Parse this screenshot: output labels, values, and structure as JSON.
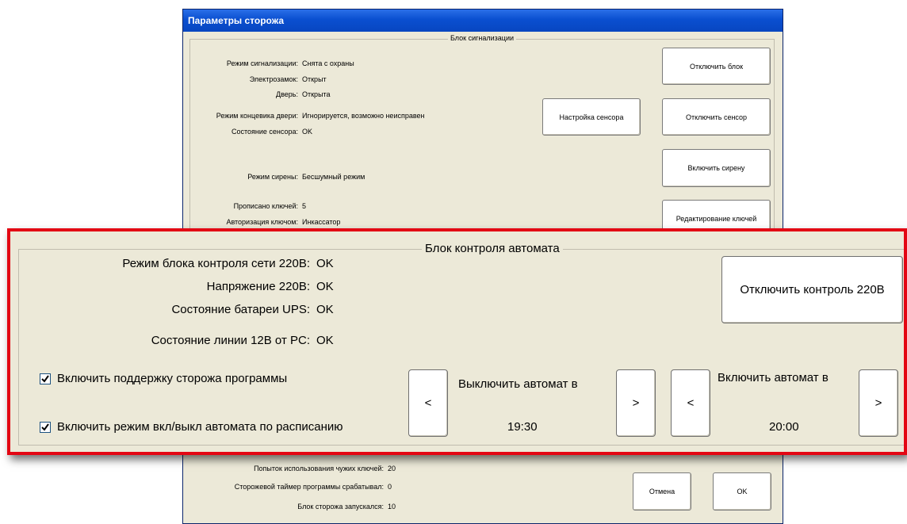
{
  "dialog": {
    "title": "Параметры сторожа",
    "signal_block": {
      "legend": "Блок сигнализации",
      "rows": [
        {
          "label": "Режим сигнализации:",
          "value": "Снята с охраны"
        },
        {
          "label": "Электрозамок:",
          "value": "Открыт"
        },
        {
          "label": "Дверь:",
          "value": "Открыта"
        },
        {
          "label": "Режим концевика двери:",
          "value": "Игнорируется, возможно неисправен"
        },
        {
          "label": "Состояние сенсора:",
          "value": "OK"
        },
        {
          "label": "Режим сирены:",
          "value": "Бесшумный режим"
        },
        {
          "label": "Прописано ключей:",
          "value": "5"
        },
        {
          "label": "Авторизация ключом:",
          "value": "Инкассатор"
        }
      ],
      "buttons": {
        "disable_block": "Отключить блок",
        "sensor_settings": "Настройка сенсора",
        "disable_sensor": "Отключить сенсор",
        "enable_siren": "Включить сирену",
        "edit_keys": "Редактирование ключей"
      }
    },
    "stats": [
      {
        "label": "Попыток использования чужих ключей:",
        "value": "20"
      },
      {
        "label": "Сторожевой таймер программы срабатывал:",
        "value": "0"
      },
      {
        "label": "Блок сторожа запускался:",
        "value": "10"
      }
    ],
    "buttons": {
      "cancel": "Отмена",
      "ok": "OK"
    }
  },
  "zoom": {
    "legend": "Блок контроля автомата",
    "rows": [
      {
        "label": "Режим блока контроля сети 220В:",
        "value": "OK"
      },
      {
        "label": "Напряжение 220В:",
        "value": "OK"
      },
      {
        "label": "Состояние батареи UPS:",
        "value": "OK"
      },
      {
        "label": "Состояние линии 12В от PC:",
        "value": "OK"
      }
    ],
    "disable_220_button": "Отключить контроль 220В",
    "checkboxes": [
      {
        "label": "Включить поддержку сторожа программы",
        "checked": true
      },
      {
        "label": "Включить режим вкл/выкл автомата по расписанию",
        "checked": true
      }
    ],
    "schedule": {
      "off_label": "Выключить автомат в",
      "off_time": "19:30",
      "on_label": "Включить автомат в",
      "on_time": "20:00",
      "prev_symbol": "<",
      "next_symbol": ">"
    }
  },
  "colors": {
    "highlight_border": "#e30613",
    "titlebar": "#0a4fd0",
    "dialog_bg": "#ece9d8"
  }
}
